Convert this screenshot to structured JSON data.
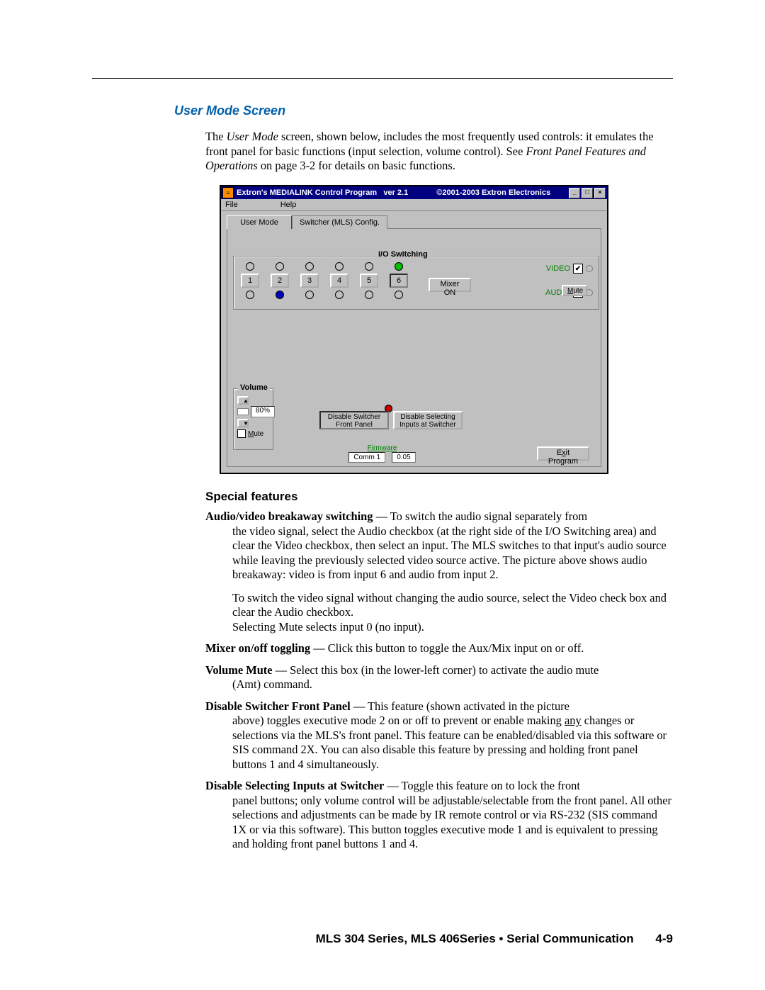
{
  "headings": {
    "user_mode_screen": "User Mode Screen",
    "special_features": "Special features"
  },
  "intro": {
    "p1a": "The ",
    "p1_it1": "User Mode",
    "p1b": " screen, shown below, includes the most frequently used controls: it emulates the front panel for basic functions (input selection, volume control).  See ",
    "p1_it2": "Front Panel Features and Operations",
    "p1c": " on page 3-2 for details on basic functions."
  },
  "features": {
    "avbs_term": "Audio/video breakaway switching",
    "avbs_lead": " — To switch the audio signal separately from",
    "avbs_body": "the video signal, select the Audio checkbox (at the right side of the I/O Switching area) and clear the Video checkbox, then select an input.  The MLS switches to that input's audio source while leaving the previously selected video source active.  The picture above shows audio breakaway: video is from input 6 and audio from input 2.",
    "avbs_body2": "To switch the video signal without changing the audio source, select the Video check box and clear the Audio checkbox.\nSelecting Mute selects input 0 (no input).",
    "mixer_term": "Mixer on/off toggling",
    "mixer_body": " — Click this button to toggle the Aux/Mix input on or off.",
    "vmute_term": "Volume Mute",
    "vmute_lead": " — Select this box (in the lower-left corner) to activate the audio mute",
    "vmute_body": "(Amt) command.",
    "dsfp_term": "Disable Switcher Front Panel",
    "dsfp_lead": " — This feature (shown activated in the picture",
    "dsfp_body_a": "above) toggles executive mode 2 on or off to prevent or enable making ",
    "dsfp_any": "any",
    "dsfp_body_b": " changes or selections via the MLS's front panel.  This feature can be enabled/disabled via this software or SIS command 2X.  You can also disable this feature by pressing and holding front panel buttons 1 and 4 simultaneously.",
    "dsis_term": "Disable Selecting Inputs at Switcher",
    "dsis_lead": " — Toggle this feature on to lock the front",
    "dsis_body": "panel buttons; only volume control will be adjustable/selectable from the front panel.  All other selections and adjustments can be made by IR remote control or via RS-232 (SIS command 1X or via this software).  This button toggles executive mode 1 and is equivalent to pressing and holding front panel buttons 1 and 4."
  },
  "footer": {
    "title": "MLS 304 Series, MLS 406Series • Serial Communication",
    "page": "4-9"
  },
  "app": {
    "title_left": "Extron's MEDIALINK Control Program",
    "title_ver": "ver 2.1",
    "title_right": "©2001-2003 Extron Electronics",
    "menu_file": "File",
    "menu_help": "Help",
    "tab_user": "User Mode",
    "tab_cfg": "Switcher (MLS) Config.",
    "io_title": "I/O Switching",
    "inputs": [
      "1",
      "2",
      "3",
      "4",
      "5",
      "6"
    ],
    "mixer": "Mixer ON",
    "video": "VIDEO",
    "audio": "AUDIO",
    "mute_mini": "Mute",
    "volume_legend": "Volume",
    "vol_value": "80%",
    "vol_mute": "Mute",
    "disable1": "Disable Switcher Front Panel",
    "disable2": "Disable Selecting Inputs at Switcher",
    "firmware": "Firmware",
    "comm": "Comm 1",
    "fw_val": "0.05",
    "exit": "Exit Program"
  }
}
